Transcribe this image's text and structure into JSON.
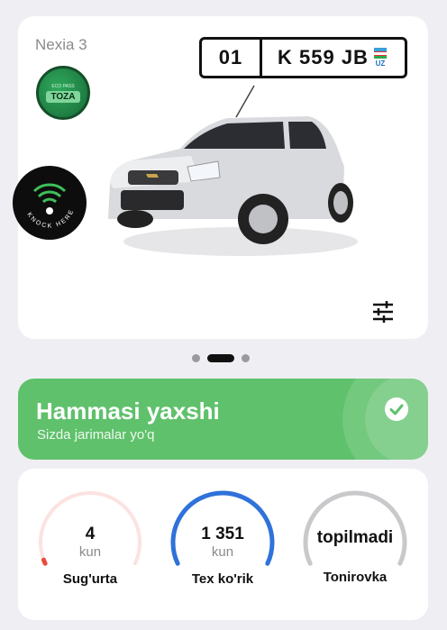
{
  "car": {
    "model": "Nexia 3",
    "plate_region": "01",
    "plate_number": "K 559 JB",
    "plate_country": "UZ",
    "eco_badge_label": "TOZA",
    "eco_badge_small": "ECO PASS",
    "knock_label": "KNOCK HERE"
  },
  "pager": {
    "count": 3,
    "active": 1
  },
  "status": {
    "title": "Hammasi yaxshi",
    "subtitle": "Sizda jarimalar yo'q",
    "color": "#5fc16b"
  },
  "stats": [
    {
      "value": "4",
      "unit": "kun",
      "label": "Sug'urta",
      "color": "#e84a3c",
      "track": "#fbe3e1",
      "fill": 0.02
    },
    {
      "value": "1 351",
      "unit": "kun",
      "label": "Tex ko'rik",
      "color": "#2f72d9",
      "track": "#dde8f8",
      "fill": 1.0
    },
    {
      "value": "topilmadi",
      "unit": "",
      "label": "Tonirovka",
      "color": "#c9c9cc",
      "track": "#e3e3e6",
      "fill": 1.0
    }
  ]
}
